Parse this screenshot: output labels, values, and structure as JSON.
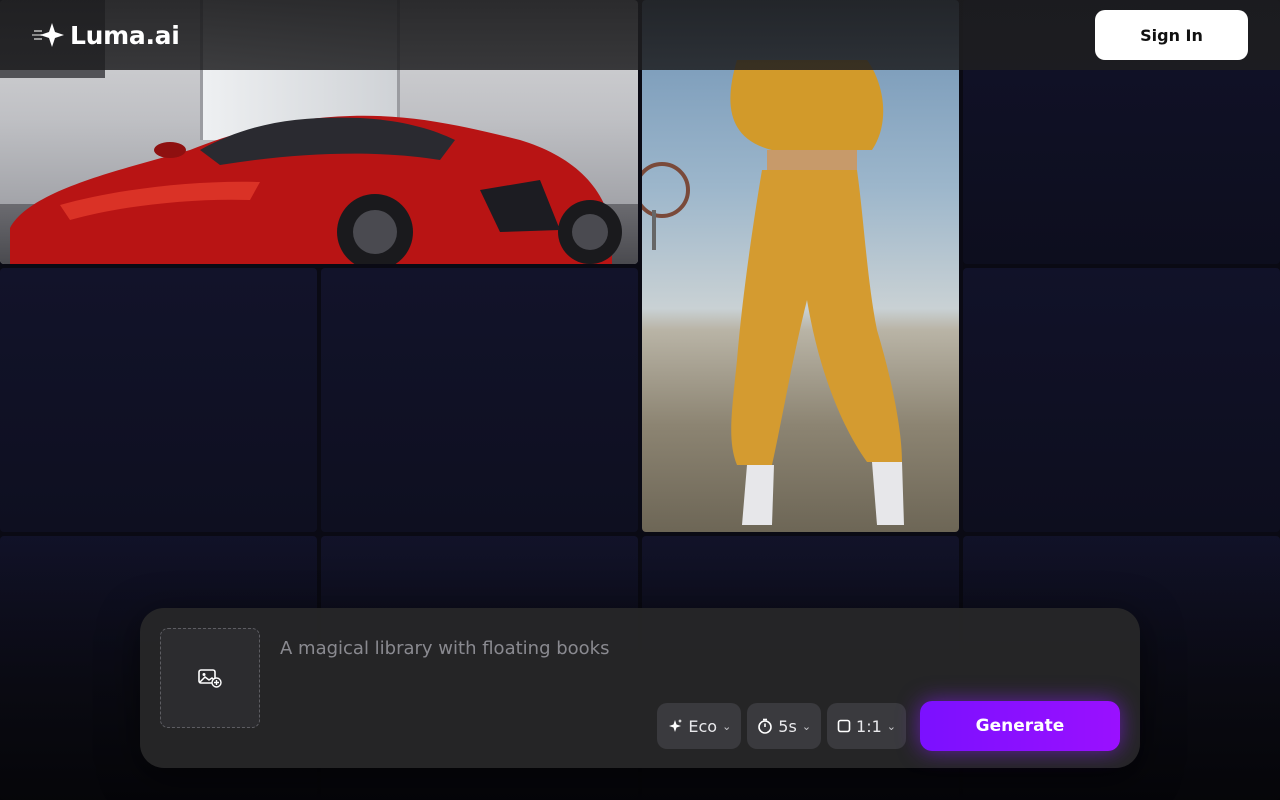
{
  "header": {
    "logo_text": "Luma.ai",
    "sign_in_label": "Sign In"
  },
  "gallery": {
    "items": [
      {
        "name": "red-sports-car-thumbnail"
      },
      {
        "name": "yellow-tracksuit-thumbnail"
      }
    ]
  },
  "composer": {
    "prompt_placeholder": "A magical library with floating books",
    "upload_icon": "image-add-icon",
    "model_label": "Eco",
    "model_icon": "sparkle-icon",
    "duration_label": "5s",
    "duration_icon": "timer-icon",
    "aspect_label": "1:1",
    "aspect_icon": "square-icon",
    "generate_label": "Generate"
  },
  "colors": {
    "accent": "#8a10ff",
    "background": "#0a0a14"
  }
}
